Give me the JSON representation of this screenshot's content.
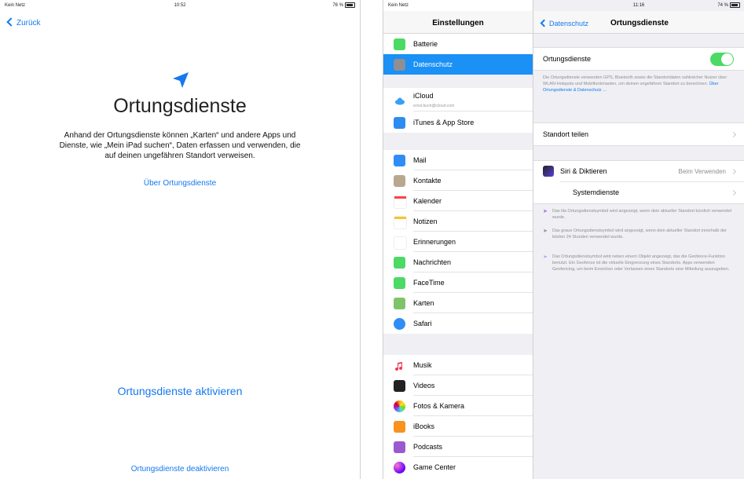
{
  "left": {
    "status": {
      "carrier": "Kein Netz",
      "time": "10:52",
      "battery": "76 %"
    },
    "back_label": "Zurück",
    "title": "Ortungsdienste",
    "description": "Anhand der Ortungsdienste können „Karten“ und andere Apps und Dienste, wie „Mein iPad suchen“, Daten erfassen und verwenden, die auf deinen ungefähren Standort verweisen.",
    "learn_link": "Über Ortungsdienste",
    "enable_button": "Ortungsdienste aktivieren",
    "disable_button": "Ortungsdienste deaktivieren"
  },
  "right": {
    "status": {
      "carrier": "Kein Netz",
      "time": "11:16",
      "battery": "74 %"
    },
    "sidebar_title": "Einstellungen",
    "sidebar": {
      "batterie": "Batterie",
      "datenschutz": "Datenschutz",
      "icloud": "iCloud",
      "icloud_sub": "ernst.buch@icloud.com",
      "itunes": "iTunes & App Store",
      "mail": "Mail",
      "kontakte": "Kontakte",
      "kalender": "Kalender",
      "notizen": "Notizen",
      "erinnerungen": "Erinnerungen",
      "nachrichten": "Nachrichten",
      "facetime": "FaceTime",
      "karten": "Karten",
      "safari": "Safari",
      "musik": "Musik",
      "videos": "Videos",
      "fotos": "Fotos & Kamera",
      "ibooks": "iBooks",
      "podcasts": "Podcasts",
      "gamecenter": "Game Center"
    },
    "detail": {
      "back_label": "Datenschutz",
      "title": "Ortungsdienste",
      "toggle_label": "Ortungsdienste",
      "toggle_on": true,
      "toggle_note": "Die Ortungsdienste verwenden GPS, Bluetooth sowie die Standortdaten zahlreicher Nutzer über WLAN-Hotspots und Mobilfunkmasten, um deinen ungefähren Standort zu berechnen.",
      "toggle_note_link": "Über Ortungsdienste & Datenschutz …",
      "share_location": "Standort teilen",
      "siri_label": "Siri & Diktieren",
      "siri_value": "Beim Verwenden",
      "system_services": "Systemdienste",
      "legend_1": "Das lila Ortungsdienstsymbol wird angezeigt, wenn dein aktueller Standort kürzlich verwendet wurde.",
      "legend_2": "Das graue Ortungsdienstsymbol wird angezeigt, wenn dein aktueller Standort innerhalb der letzten 24 Stunden verwendet wurde.",
      "legend_3": "Das Ortungsdienstsymbol wird neben einem Objekt angezeigt, das die Geofence-Funktion benutzt. Ein Geofence ist die virtuelle Eingrenzung eines Standorts. Apps verwenden Geofencing, um beim Erreichen oder Verlassen eines Standorts eine Mitteilung auszugeben."
    }
  },
  "colors": {
    "ios_blue": "#1479ee",
    "selection_blue": "#1b90f5",
    "toggle_green": "#4cd964"
  }
}
